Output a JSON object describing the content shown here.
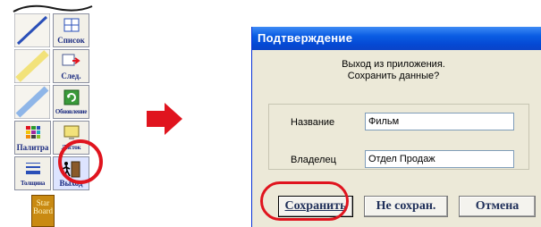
{
  "palette": {
    "buttons": [
      {
        "label": "Список",
        "icon": "list-icon"
      },
      {
        "label": "След.",
        "icon": "next-page-icon"
      },
      {
        "label": "Обновление",
        "icon": "refresh-icon"
      },
      {
        "label": "Палитра",
        "icon": "palette-icon"
      },
      {
        "label": "Листок",
        "icon": "screen-icon"
      },
      {
        "label": "Толщина",
        "icon": "thickness-icon"
      },
      {
        "label": "Выход",
        "icon": "exit-door-icon"
      }
    ],
    "start_board": {
      "line1": "Star",
      "line2": "Board"
    }
  },
  "dialog": {
    "title": "Подтверждение",
    "message_line1": "Выход из приложения.",
    "message_line2": "Сохранить данные?",
    "fields": {
      "name_label": "Название",
      "name_value": "Фильм",
      "owner_label": "Владелец",
      "owner_value": "Отдел Продаж"
    },
    "buttons": {
      "save": "Сохранить",
      "dont_save": "Не сохран.",
      "cancel": "Отмена"
    }
  },
  "colors": {
    "highlight": "#e0141e",
    "title_bar": "#0a5ce3",
    "dialog_bg": "#ece9d8"
  }
}
